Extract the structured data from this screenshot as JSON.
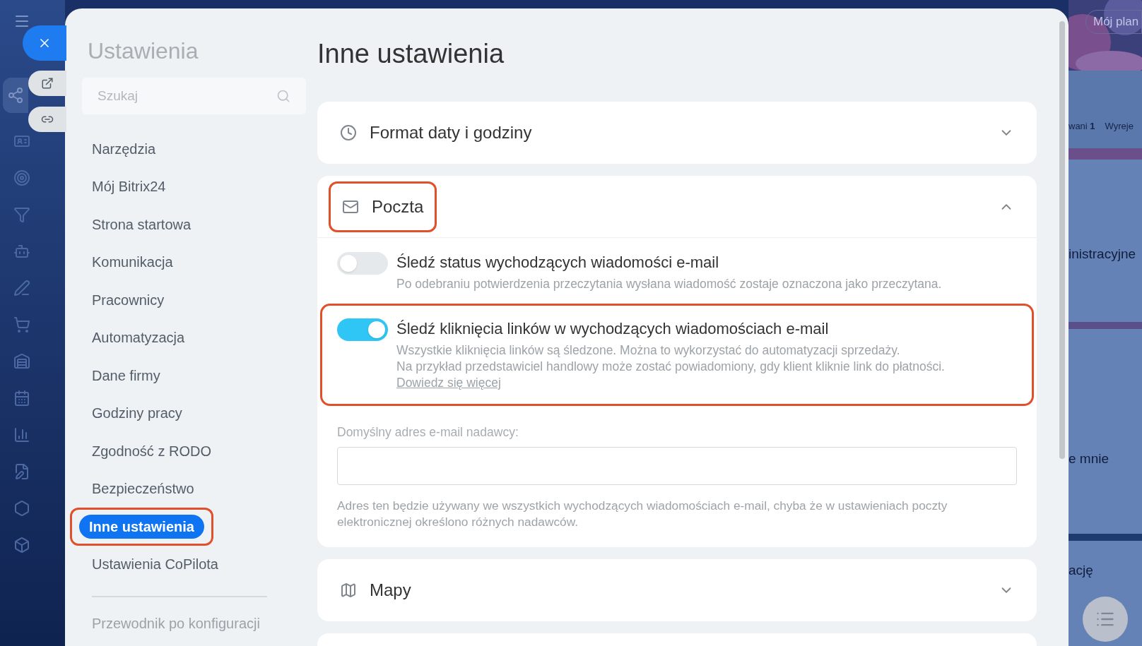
{
  "background_page": {
    "plan_button": "Mój plan",
    "tabs": [
      "wani **1**",
      "Wyreje"
    ],
    "texts": [
      "inistracyjne",
      "e mnie",
      "ację"
    ]
  },
  "settings": {
    "title": "Ustawienia",
    "search": {
      "placeholder": "Szukaj"
    },
    "nav": [
      {
        "label": "Narzędzia",
        "selected": false,
        "highlighted": false
      },
      {
        "label": "Mój Bitrix24",
        "selected": false,
        "highlighted": false
      },
      {
        "label": "Strona startowa",
        "selected": false,
        "highlighted": false
      },
      {
        "label": "Komunikacja",
        "selected": false,
        "highlighted": false
      },
      {
        "label": "Pracownicy",
        "selected": false,
        "highlighted": false
      },
      {
        "label": "Automatyzacja",
        "selected": false,
        "highlighted": false
      },
      {
        "label": "Dane firmy",
        "selected": false,
        "highlighted": false
      },
      {
        "label": "Godziny pracy",
        "selected": false,
        "highlighted": false
      },
      {
        "label": "Zgodność z RODO",
        "selected": false,
        "highlighted": false
      },
      {
        "label": "Bezpieczeństwo",
        "selected": false,
        "highlighted": false
      },
      {
        "label": "Inne ustawienia",
        "selected": true,
        "highlighted": true
      },
      {
        "label": "Ustawienia CoPilota",
        "selected": false,
        "highlighted": false
      }
    ],
    "footer_link": "Przewodnik po konfiguracji"
  },
  "page": {
    "title": "Inne ustawienia",
    "sections": [
      {
        "kind": "clock",
        "title": "Format daty i godziny",
        "expanded": false,
        "highlighted": false
      },
      {
        "kind": "mail",
        "title": "Poczta",
        "expanded": true,
        "highlighted": true,
        "options": [
          {
            "title": "Śledź status wychodzących wiadomości e-mail",
            "on": false,
            "highlighted": false,
            "description": [
              "Po odebraniu potwierdzenia przeczytania wysłana wiadomość zostaje oznaczona jako przeczytana."
            ]
          },
          {
            "title": "Śledź kliknięcia linków w wychodzących wiadomościach e-mail",
            "on": true,
            "highlighted": true,
            "description": [
              "Wszystkie kliknięcia linków są śledzone. Można to wykorzystać do automatyzacji sprzedaży.",
              "Na przykład przedstawiciel handlowy może zostać powiadomiony, gdy klient kliknie link do płatności."
            ],
            "link": "Dowiedz się więcej"
          }
        ],
        "field": {
          "label": "Domyślny adres e-mail nadawcy:"
        },
        "hint": "Adres ten będzie używany we wszystkich wychodzących wiadomościach e-mail, chyba że w ustawieniach poczty elektronicznej określono różnych nadawców."
      },
      {
        "kind": "map",
        "title": "Mapy",
        "expanded": false,
        "highlighted": false
      }
    ]
  }
}
